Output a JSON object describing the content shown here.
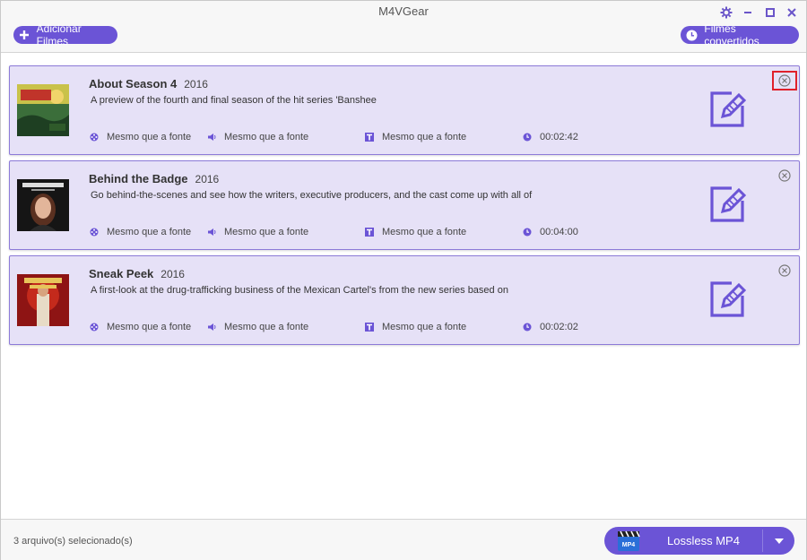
{
  "app": {
    "title": "M4VGear"
  },
  "toolbar": {
    "add_label": "Adicionar Filmes",
    "converted_label": "Filmes convertidos"
  },
  "items": [
    {
      "title": "About Season 4",
      "year": "2016",
      "description": "A preview of the fourth and final season of the hit series 'Banshee",
      "video": "Mesmo que a fonte",
      "audio": "Mesmo que a fonte",
      "subtitle": "Mesmo que a fonte",
      "duration": "00:02:42",
      "thumb_text": "BANSHEE"
    },
    {
      "title": "Behind the Badge",
      "year": "2016",
      "description": "Go behind-the-scenes and see how the writers, executive producers, and the cast come up with all of",
      "video": "Mesmo que a fonte",
      "audio": "Mesmo que a fonte",
      "subtitle": "Mesmo que a fonte",
      "duration": "00:04:00",
      "thumb_text": "ANGIE TRIBECA"
    },
    {
      "title": "Sneak Peek",
      "year": "2016",
      "description": "A first-look at the drug-trafficking business of the Mexican Cartel's from the new series based on",
      "video": "Mesmo que a fonte",
      "audio": "Mesmo que a fonte",
      "subtitle": "Mesmo que a fonte",
      "duration": "00:02:02",
      "thumb_text": "QUEEN OF THE SOUTH"
    }
  ],
  "footer": {
    "status": "3 arquivo(s) selecionado(s)",
    "format_label": "Lossless MP4",
    "format_icon_text": "MP4"
  },
  "colors": {
    "accent": "#6b54d6",
    "item_bg": "#e6e1f7",
    "item_border": "#8c7ad8",
    "highlight": "#e0202a"
  },
  "icons": {
    "add": "plus-icon",
    "converted": "clock-icon",
    "video": "film-reel-icon",
    "audio": "speaker-icon",
    "subtitle": "text-t-icon",
    "duration": "clock-icon",
    "edit": "edit-pencil-icon",
    "remove": "circle-x-icon"
  }
}
